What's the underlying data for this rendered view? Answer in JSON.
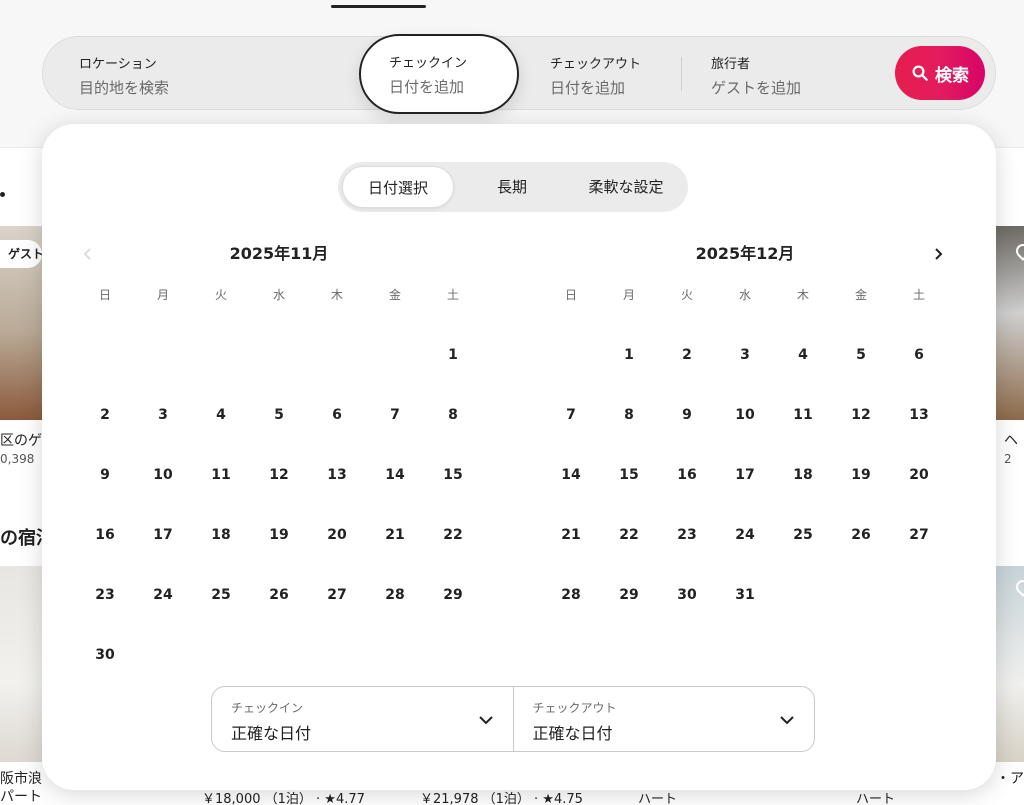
{
  "search": {
    "location_label": "ロケーション",
    "location_value": "目的地を検索",
    "checkin_label": "チェックイン",
    "checkin_value": "日付を追加",
    "checkout_label": "チェックアウト",
    "checkout_value": "日付を追加",
    "guests_label": "旅行者",
    "guests_value": "ゲストを追加",
    "search_button": "検索"
  },
  "tabs": [
    {
      "label": "日付選択",
      "active": true
    },
    {
      "label": "長期",
      "active": false
    },
    {
      "label": "柔軟な設定",
      "active": false
    }
  ],
  "weekdays": [
    "日",
    "月",
    "火",
    "水",
    "木",
    "金",
    "土"
  ],
  "months": [
    {
      "title": "2025年11月",
      "offset": 6,
      "days": 30
    },
    {
      "title": "2025年12月",
      "offset": 1,
      "days": 31
    }
  ],
  "exact": {
    "checkin_label": "チェックイン",
    "checkin_value": "正確な日付",
    "checkout_label": "チェックアウト",
    "checkout_value": "正確な日付"
  },
  "background": {
    "badge": "ゲスト",
    "card1_title": "区のゲ",
    "card1_price": "0,398",
    "card2_title": "ヘ",
    "card2_price": "2",
    "section_title": "の宿泊",
    "card3_title": "阪市浪",
    "card3_sub": "パート",
    "price_a": "￥18,000 （1泊） · ★4.77",
    "price_b": "￥21,978 （1泊） · ★4.75",
    "sub_c": "ハート",
    "sub_d": "ハート",
    "card4_title": "・ア"
  },
  "colors": {
    "brand": "#e61e4d",
    "text": "#222222",
    "muted": "#6a6a6a"
  }
}
